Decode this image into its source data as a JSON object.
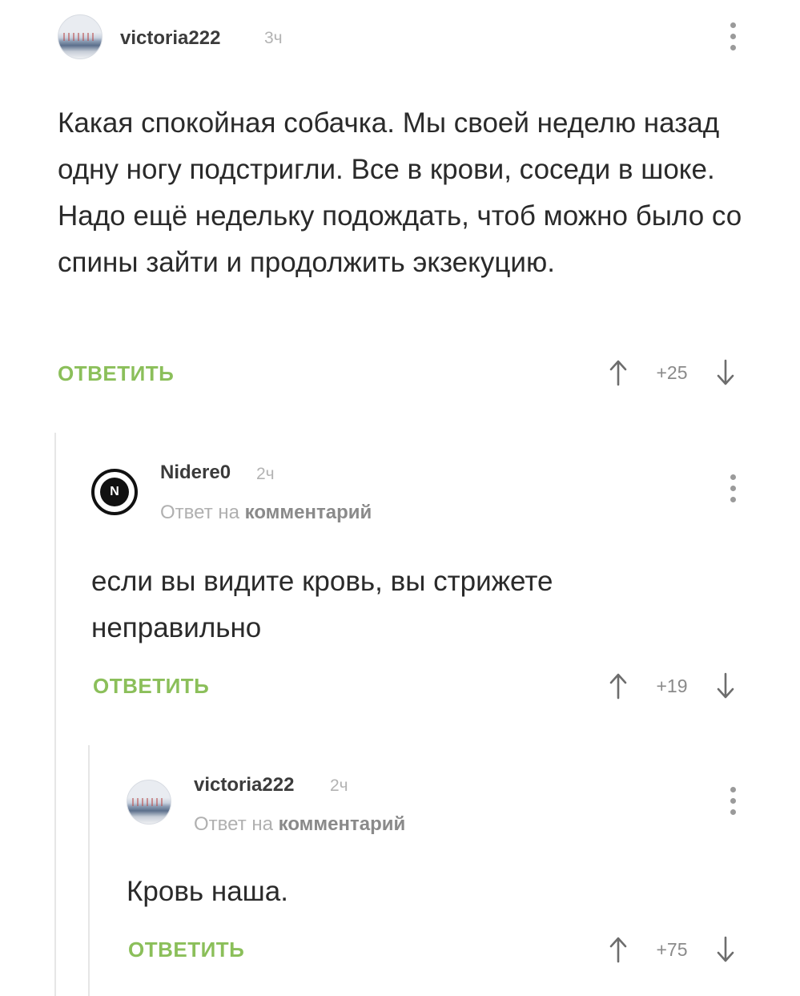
{
  "comments": [
    {
      "author": "victoria222",
      "time": "3ч",
      "text": "Какая спокойная собачка. Мы своей неделю назад одну ногу подстригли. Все в крови, соседи в шоке. Надо ещё недельку подождать, чтоб можно было со спины зайти и продолжить экзекуцию.",
      "reply_label": "ОТВЕТИТЬ",
      "score": "+25"
    },
    {
      "author": "Nidere0",
      "avatar_letter": "N",
      "time": "2ч",
      "reply_to_prefix": "Ответ на ",
      "reply_to_link": "комментарий",
      "text": "если вы видите кровь, вы стрижете неправильно",
      "reply_label": "ОТВЕТИТЬ",
      "score": "+19"
    },
    {
      "author": "victoria222",
      "time": "2ч",
      "reply_to_prefix": "Ответ на ",
      "reply_to_link": "комментарий",
      "text": "Кровь наша.",
      "reply_label": "ОТВЕТИТЬ",
      "score": "+75"
    }
  ],
  "colors": {
    "reply_button": "#8bbf5a",
    "text": "#2a2a2a",
    "muted": "#b0b0b0"
  },
  "icons": [
    "avatar-photo",
    "avatar-letter-badge",
    "more-options-icon",
    "upvote-arrow-icon",
    "downvote-arrow-icon"
  ]
}
